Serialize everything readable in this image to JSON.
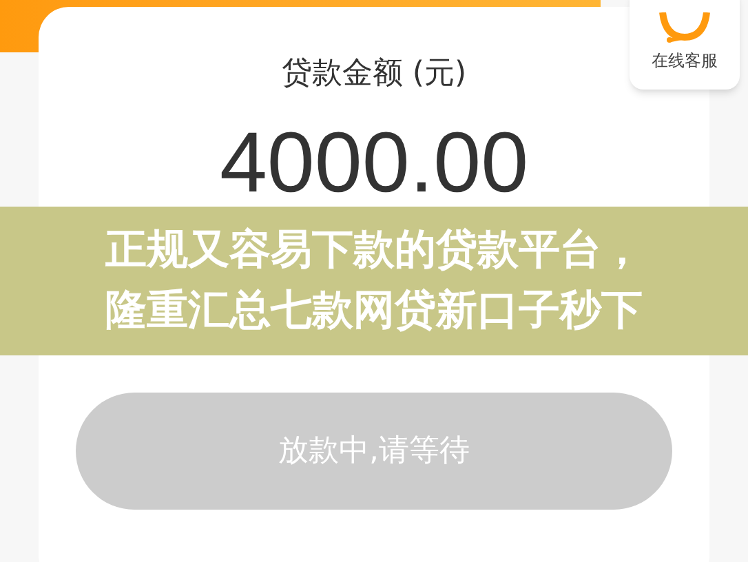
{
  "service": {
    "label": "在线客服"
  },
  "loan": {
    "label": "贷款金额 (元)",
    "amount": "4000.00"
  },
  "banner": {
    "lines": [
      "正规又容易下款的贷款平台，",
      "隆重汇总七款网贷新口子秒下"
    ]
  },
  "button": {
    "label": "放款中,请等待",
    "disabled": true
  }
}
